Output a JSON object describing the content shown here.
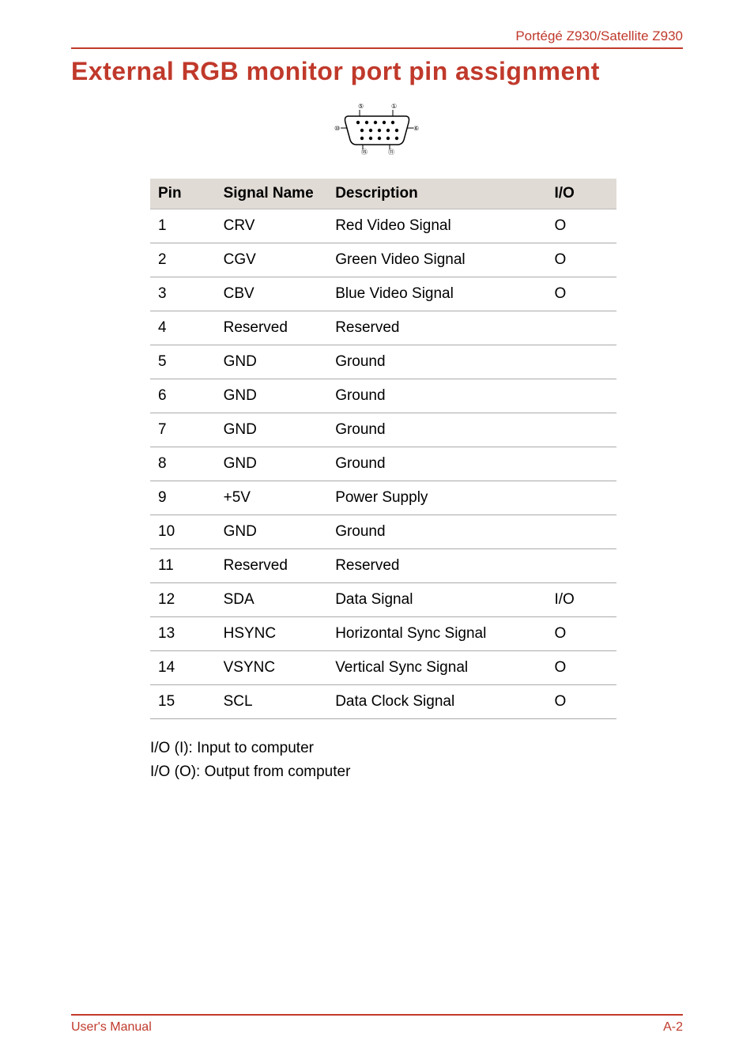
{
  "header": {
    "product": "Portégé Z930/Satellite Z930"
  },
  "title": "External RGB monitor port pin assignment",
  "table": {
    "headers": {
      "pin": "Pin",
      "signal": "Signal Name",
      "desc": "Description",
      "io": "I/O"
    },
    "rows": [
      {
        "pin": "1",
        "signal": "CRV",
        "desc": "Red Video Signal",
        "io": "O"
      },
      {
        "pin": "2",
        "signal": "CGV",
        "desc": "Green Video Signal",
        "io": "O"
      },
      {
        "pin": "3",
        "signal": "CBV",
        "desc": "Blue Video Signal",
        "io": "O"
      },
      {
        "pin": "4",
        "signal": "Reserved",
        "desc": "Reserved",
        "io": ""
      },
      {
        "pin": "5",
        "signal": "GND",
        "desc": "Ground",
        "io": ""
      },
      {
        "pin": "6",
        "signal": "GND",
        "desc": "Ground",
        "io": ""
      },
      {
        "pin": "7",
        "signal": "GND",
        "desc": "Ground",
        "io": ""
      },
      {
        "pin": "8",
        "signal": "GND",
        "desc": "Ground",
        "io": ""
      },
      {
        "pin": "9",
        "signal": "+5V",
        "desc": "Power Supply",
        "io": ""
      },
      {
        "pin": "10",
        "signal": "GND",
        "desc": "Ground",
        "io": ""
      },
      {
        "pin": "11",
        "signal": "Reserved",
        "desc": "Reserved",
        "io": ""
      },
      {
        "pin": "12",
        "signal": "SDA",
        "desc": "Data Signal",
        "io": "I/O"
      },
      {
        "pin": "13",
        "signal": "HSYNC",
        "desc": "Horizontal Sync Signal",
        "io": "O"
      },
      {
        "pin": "14",
        "signal": "VSYNC",
        "desc": "Vertical Sync Signal",
        "io": "O"
      },
      {
        "pin": "15",
        "signal": "SCL",
        "desc": "Data Clock Signal",
        "io": "O"
      }
    ]
  },
  "notes": {
    "line1": "I/O (I): Input to computer",
    "line2": "I/O (O): Output from computer"
  },
  "footer": {
    "left": "User's Manual",
    "right": "A-2"
  },
  "diagram": {
    "corner_labels": {
      "tl": "5",
      "tr": "1",
      "ml": "10",
      "mr": "6",
      "bl": "15",
      "br": "11"
    }
  }
}
